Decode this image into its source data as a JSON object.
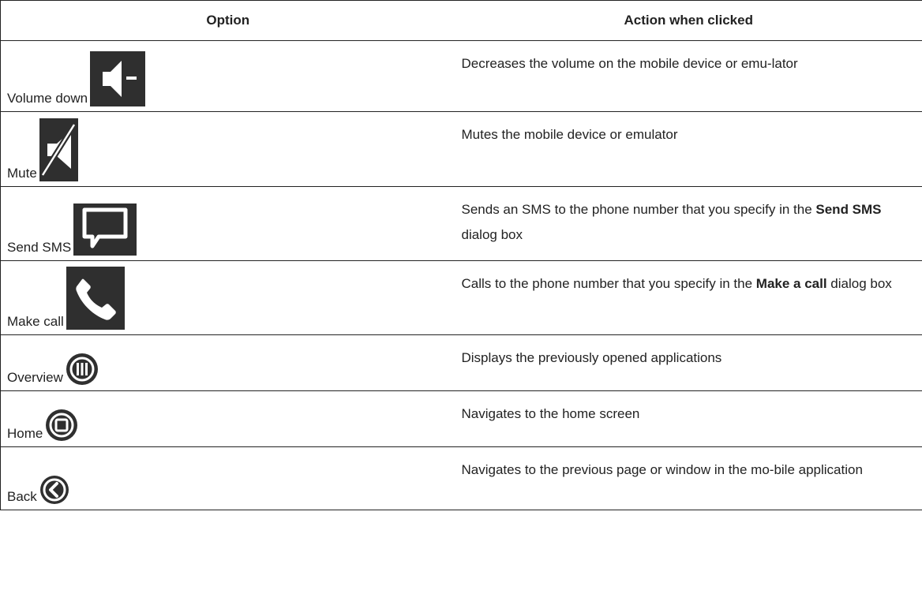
{
  "table": {
    "headers": {
      "option": "Option",
      "action": "Action when clicked"
    },
    "rows": [
      {
        "option": "Volume down",
        "icon": "volume-down-icon",
        "action_before": "Decreases the volume on the mobile device or emu-lator",
        "action_bold": "",
        "action_after": ""
      },
      {
        "option": "Mute",
        "icon": "mute-icon",
        "action_before": "Mutes the mobile device or emulator",
        "action_bold": "",
        "action_after": ""
      },
      {
        "option": "Send SMS",
        "icon": "message-icon",
        "action_before": "Sends an SMS to the phone number that you specify in the ",
        "action_bold": "Send SMS",
        "action_after": " dialog box"
      },
      {
        "option": "Make call",
        "icon": "phone-icon",
        "action_before": "Calls to the phone number that you specify in the ",
        "action_bold": "Make a call",
        "action_after": " dialog box"
      },
      {
        "option": "Overview",
        "icon": "overview-icon",
        "action_before": "Displays the previously opened applications",
        "action_bold": "",
        "action_after": ""
      },
      {
        "option": "Home",
        "icon": "home-icon",
        "action_before": "Navigates to the home screen",
        "action_bold": "",
        "action_after": ""
      },
      {
        "option": "Back",
        "icon": "back-icon",
        "action_before": "Navigates to the previous page or window in the mo-bile application",
        "action_bold": "",
        "action_after": ""
      }
    ]
  },
  "colors": {
    "icon_bg": "#2f2f2f",
    "icon_fg": "#ffffff",
    "border": "#222222"
  }
}
